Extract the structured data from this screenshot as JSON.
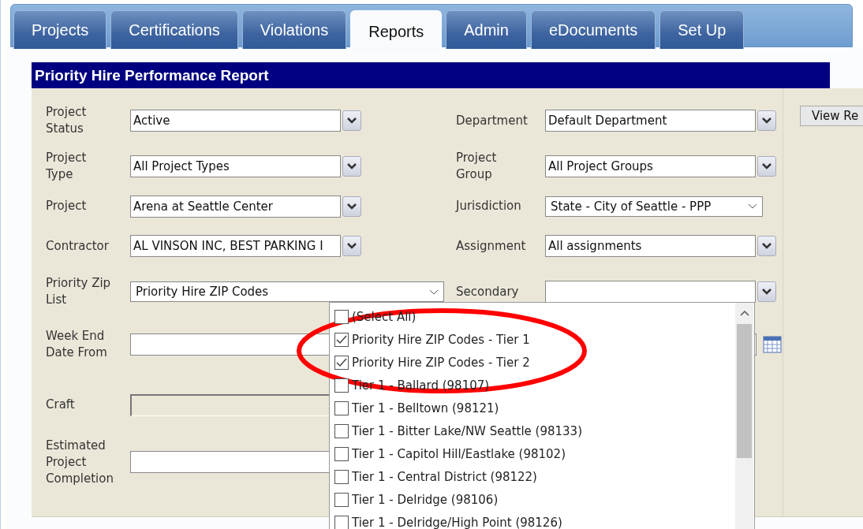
{
  "tabs": [
    {
      "label": "Projects",
      "selected": false
    },
    {
      "label": "Certifications",
      "selected": false
    },
    {
      "label": "Violations",
      "selected": false
    },
    {
      "label": "Reports",
      "selected": true
    },
    {
      "label": "Admin",
      "selected": false
    },
    {
      "label": "eDocuments",
      "selected": false
    },
    {
      "label": "Set Up",
      "selected": false
    }
  ],
  "report": {
    "title": "Priority Hire Performance Report",
    "view_button": "View Re"
  },
  "rows": [
    {
      "left": {
        "label": "Project\nStatus",
        "kind": "combo",
        "value": "Active"
      },
      "right": {
        "label": "Department",
        "kind": "combo",
        "value": "Default Department"
      }
    },
    {
      "left": {
        "label": "Project\nType",
        "kind": "combo",
        "value": "All Project Types"
      },
      "right": {
        "label": "Project\nGroup",
        "kind": "combo",
        "value": "All Project Groups"
      }
    },
    {
      "left": {
        "label": "Project",
        "kind": "combo",
        "value": "Arena at Seattle Center"
      },
      "right": {
        "label": "Jurisdiction",
        "kind": "native",
        "value": "State - City of Seattle - PPP"
      }
    },
    {
      "left": {
        "label": "Contractor",
        "kind": "combo",
        "value": "AL VINSON INC, BEST PARKING I"
      },
      "right": {
        "label": "Assignment",
        "kind": "combo",
        "value": "All assignments"
      }
    },
    {
      "left": {
        "label": "Priority Zip\nList",
        "kind": "wide",
        "value": "Priority Hire ZIP Codes"
      },
      "right": {
        "label": "Secondary",
        "kind": "combo"
      }
    },
    {
      "left": {
        "label": "Week End\nDate From",
        "kind": "date"
      }
    },
    {
      "left": {
        "label": "Craft",
        "kind": "disabled"
      }
    },
    {
      "left": {
        "label": "Estimated\nProject\nCompletion",
        "kind": "text"
      }
    }
  ],
  "zip_dropdown": {
    "options": [
      {
        "label": "(Select All)",
        "checked": false
      },
      {
        "label": "Priority Hire ZIP Codes - Tier 1",
        "checked": true
      },
      {
        "label": "Priority Hire ZIP Codes - Tier 2",
        "checked": true
      },
      {
        "label": "Tier 1 - Ballard (98107)",
        "checked": false
      },
      {
        "label": "Tier 1 - Belltown (98121)",
        "checked": false
      },
      {
        "label": "Tier 1 - Bitter Lake/NW Seattle (98133)",
        "checked": false
      },
      {
        "label": "Tier 1 - Capitol Hill/Eastlake (98102)",
        "checked": false
      },
      {
        "label": "Tier 1 - Central District (98122)",
        "checked": false
      },
      {
        "label": "Tier 1 - Delridge (98106)",
        "checked": false
      },
      {
        "label": "Tier 1 - Delridge/High Point (98126)",
        "checked": false
      }
    ]
  }
}
